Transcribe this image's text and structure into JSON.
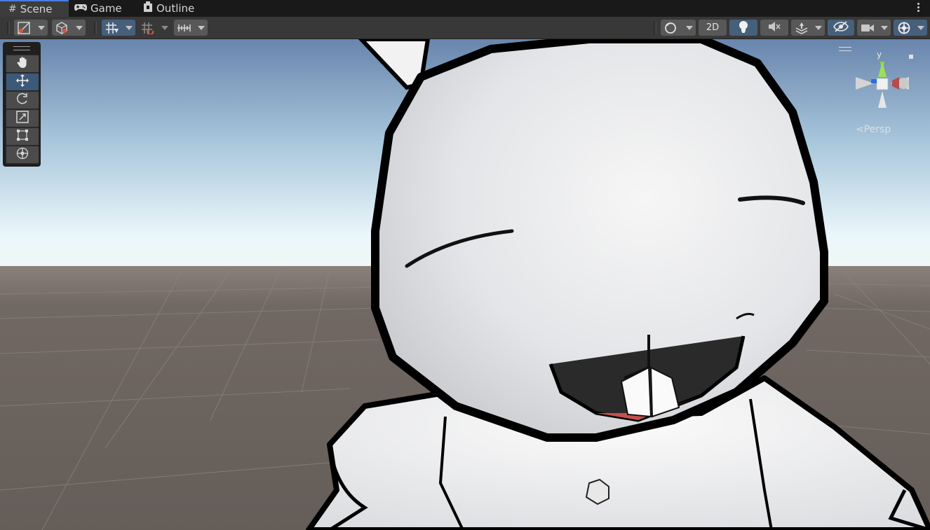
{
  "tabs": [
    {
      "label": "Scene",
      "icon": "grid-hash-icon",
      "active": true
    },
    {
      "label": "Game",
      "icon": "gamepad-icon",
      "active": false
    },
    {
      "label": "Outline",
      "icon": "outline-icon",
      "active": false
    }
  ],
  "toolbar": {
    "mode_2d_label": "2D"
  },
  "tools": [
    {
      "name": "hand-tool",
      "active": false
    },
    {
      "name": "move-tool",
      "active": true
    },
    {
      "name": "rotate-tool",
      "active": false
    },
    {
      "name": "scale-tool",
      "active": false
    },
    {
      "name": "rect-tool",
      "active": false
    },
    {
      "name": "transform-tool",
      "active": false
    }
  ],
  "gizmo": {
    "axis_label": "y",
    "projection_label": "Persp"
  },
  "colors": {
    "accent": "#4c7de2",
    "active_button": "#46607c",
    "sky_top": "#6b8bb3",
    "horizon": "#eef7fb",
    "ground": "#6a625d"
  }
}
